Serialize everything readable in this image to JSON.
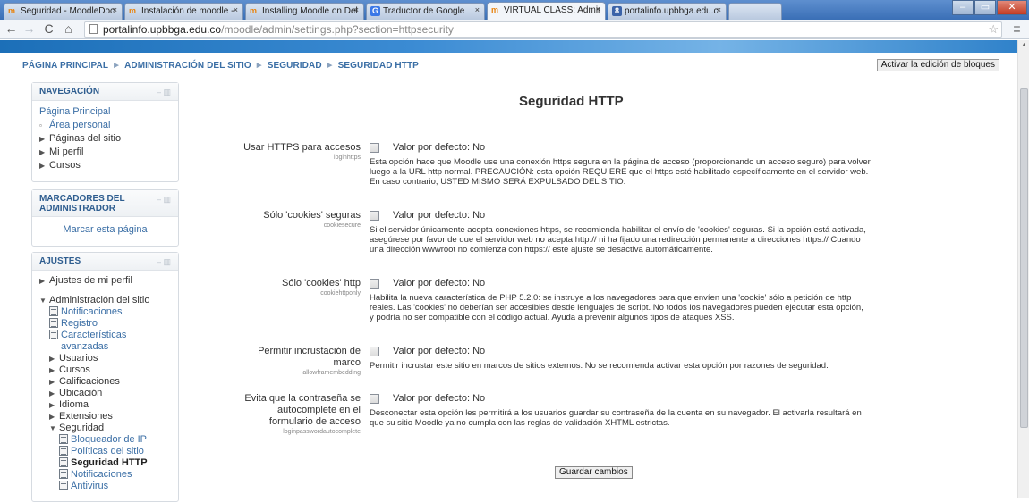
{
  "browser": {
    "tabs": [
      {
        "label": "Seguridad - MoodleDoc",
        "favicon": "m",
        "active": false
      },
      {
        "label": "Instalación de moodle -",
        "favicon": "m",
        "active": false
      },
      {
        "label": "Installing Moodle on Del",
        "favicon": "m",
        "active": false
      },
      {
        "label": "Traductor de Google",
        "favicon": "g",
        "active": false
      },
      {
        "label": "VIRTUAL CLASS: Admin",
        "favicon": "m",
        "active": true
      },
      {
        "label": "portalinfo.upbbga.edu.c",
        "favicon": "p",
        "active": false
      }
    ],
    "url_domain": "portalinfo.upbbga.edu.co",
    "url_path": "/moodle/admin/settings.php?section=httpsecurity"
  },
  "breadcrumb": {
    "items": [
      "PÁGINA PRINCIPAL",
      "ADMINISTRACIÓN DEL SITIO",
      "SEGURIDAD",
      "SEGURIDAD HTTP"
    ],
    "separator": "►"
  },
  "edit_blocks_label": "Activar la edición de bloques",
  "navigation": {
    "title": "NAVEGACIÓN",
    "items": [
      "Página Principal",
      "Área personal",
      "Páginas del sitio",
      "Mi perfil",
      "Cursos"
    ]
  },
  "admin_bookmarks": {
    "title_line1": "MARCADORES DEL",
    "title_line2": "ADMINISTRADOR",
    "link": "Marcar esta página"
  },
  "settings_block": {
    "title": "AJUSTES",
    "profile": "Ajustes de mi perfil",
    "site_admin": "Administración del sitio",
    "items": [
      "Notificaciones",
      "Registro",
      "Características",
      "avanzadas",
      "Usuarios",
      "Cursos",
      "Calificaciones",
      "Ubicación",
      "Idioma",
      "Extensiones",
      "Seguridad",
      "Bloqueador de IP",
      "Políticas del sitio",
      "Seguridad HTTP",
      "Notificaciones",
      "Antivirus"
    ]
  },
  "page_title": "Seguridad HTTP",
  "settings": [
    {
      "label": "Usar HTTPS para accesos",
      "key": "loginhttps",
      "default": "Valor por defecto: No",
      "desc": [
        "Esta opción hace que Moodle use una conexión https segura en la página de acceso (proporcionando un acceso seguro) para volver",
        "luego a la URL http normal. PRECAUCIÓN: esta opción REQUIERE que el https esté habilitado específicamente en el servidor web.",
        "En caso contrario, USTED MISMO SERÁ EXPULSADO DEL SITIO."
      ]
    },
    {
      "label": "Sólo 'cookies' seguras",
      "key": "cookiesecure",
      "default": "Valor por defecto: No",
      "desc": [
        "Si el servidor únicamente acepta conexiones https, se recomienda habilitar el envío de 'cookies' seguras. Si la opción está activada,",
        "asegúrese por favor de que el servidor web no acepta http:// ni ha fijado una redirección permanente a direcciones https:// Cuando",
        "una dirección wwwroot no comienza con https:// este ajuste se desactiva automáticamente."
      ]
    },
    {
      "label": "Sólo 'cookies' http",
      "key": "cookiehttponly",
      "default": "Valor por defecto: No",
      "desc": [
        "Habilita la nueva característica de PHP 5.2.0: se instruye a los navegadores para que envíen una 'cookie' sólo a petición de http",
        "reales. Las 'cookies' no deberían ser accesibles desde lenguajes de script. No todos los navegadores pueden ejecutar esta opción,",
        "y podría no ser compatible con el código actual. Ayuda a prevenir algunos tipos de ataques XSS."
      ]
    },
    {
      "label_line1": "Permitir incrustación de",
      "label_line2": "marco",
      "key": "allowframembedding",
      "default": "Valor por defecto: No",
      "desc": [
        "Permitir incrustar este sitio en marcos de sitios externos. No se recomienda activar esta opción por razones de seguridad."
      ]
    },
    {
      "label_line1": "Evita que la contraseña se",
      "label_line2": "autocomplete en el",
      "label_line3": "formulario de acceso",
      "key": "loginpasswordautocomplete",
      "default": "Valor por defecto: No",
      "desc": [
        "Desconectar esta opción les permitirá a los usuarios guardar su contraseña de la cuenta en su navegador. El activarla resultará en",
        "que su sitio Moodle ya no cumpla con las reglas de validación XHTML estrictas."
      ]
    }
  ],
  "save_label": "Guardar cambios"
}
